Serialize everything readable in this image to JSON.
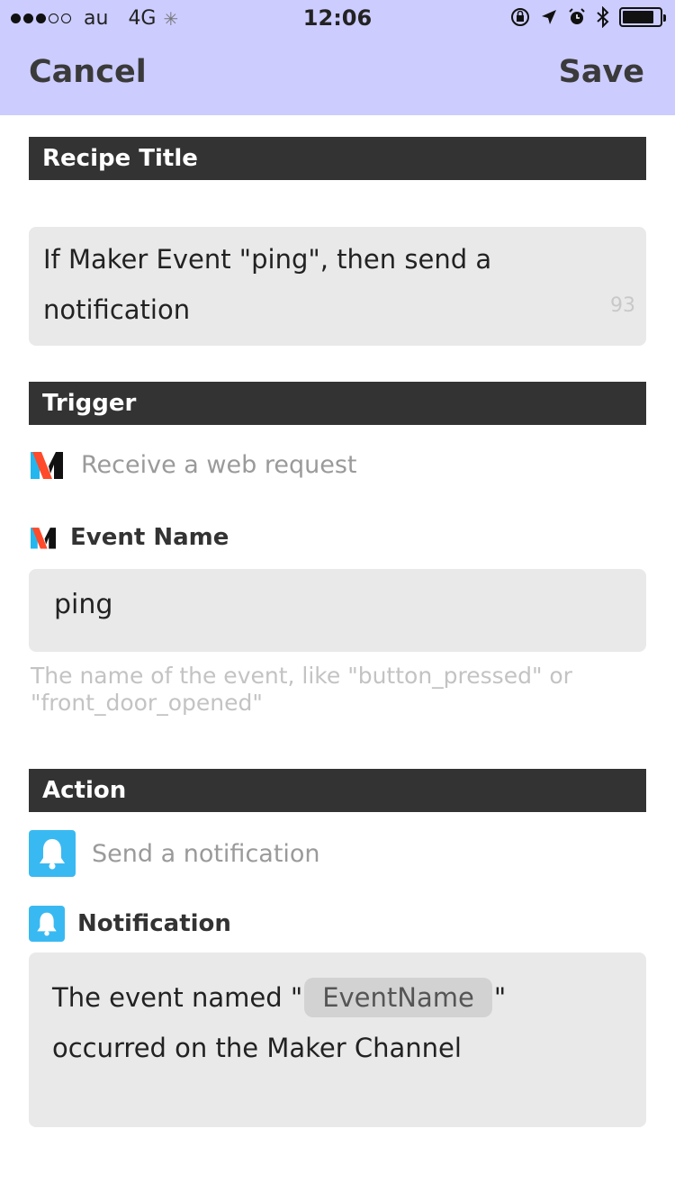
{
  "status_bar": {
    "carrier": "au",
    "network": "4G",
    "time": "12:06"
  },
  "nav": {
    "cancel_label": "Cancel",
    "save_label": "Save"
  },
  "recipe_title": {
    "header": "Recipe Title",
    "value": "If Maker Event \"ping\", then send a notification",
    "char_count": "93"
  },
  "trigger": {
    "header": "Trigger",
    "channel_icon": "maker-icon",
    "description": "Receive a web request",
    "field_label": "Event Name",
    "field_value": "ping",
    "hint": "The name of the event, like \"button_pressed\" or \"front_door_opened\""
  },
  "action": {
    "header": "Action",
    "channel_icon": "bell-icon",
    "description": "Send a notification",
    "field_label": "Notification",
    "message_prefix": "The event named \"",
    "ingredient": "EventName",
    "message_mid": "\"",
    "message_suffix": "occurred on the Maker Channel"
  },
  "colors": {
    "header_bg": "#ccccff",
    "section_bar": "#333333",
    "field_bg": "#e9e9e9",
    "notification_blue": "#39b9f2"
  }
}
